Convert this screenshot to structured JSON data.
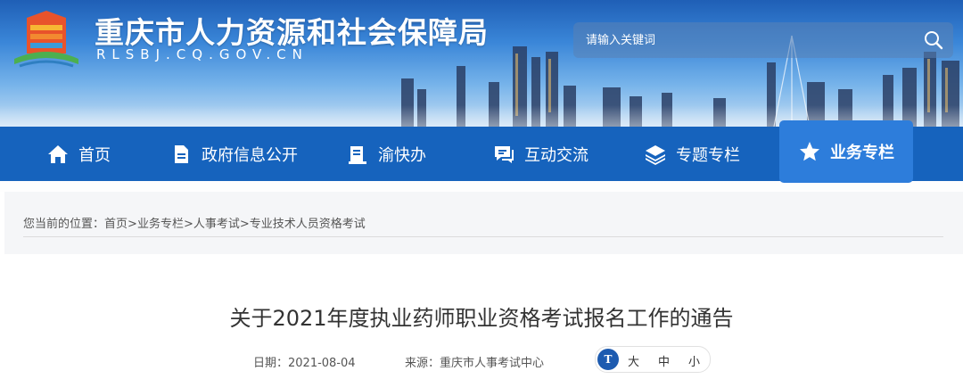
{
  "header": {
    "site_title": "重庆市人力资源和社会保障局",
    "site_domain": "RLSBJ.CQ.GOV.CN",
    "search": {
      "placeholder": "请输入关键词"
    }
  },
  "nav": {
    "items": [
      {
        "label": "首页",
        "icon": "home-icon"
      },
      {
        "label": "政府信息公开",
        "icon": "document-icon"
      },
      {
        "label": "渝快办",
        "icon": "clipboard-icon"
      },
      {
        "label": "互动交流",
        "icon": "chat-icon"
      },
      {
        "label": "专题专栏",
        "icon": "layers-icon"
      },
      {
        "label": "业务专栏",
        "icon": "star-icon",
        "active": true
      }
    ]
  },
  "breadcrumb": {
    "prefix": "您当前的位置：",
    "items": [
      "首页",
      "业务专栏",
      "人事考试",
      "专业技术人员资格考试"
    ],
    "separator": ">"
  },
  "article": {
    "title": "关于2021年度执业药师职业资格考试报名工作的通告",
    "date": "日期：2021-08-04",
    "source": "来源：重庆市人事考试中心",
    "font_size": {
      "icon_text": "T",
      "options": [
        "大",
        "中",
        "小"
      ]
    }
  },
  "colors": {
    "nav_bg": "#1663bd",
    "nav_active": "#2d7ddb",
    "title_text": "#333333"
  }
}
